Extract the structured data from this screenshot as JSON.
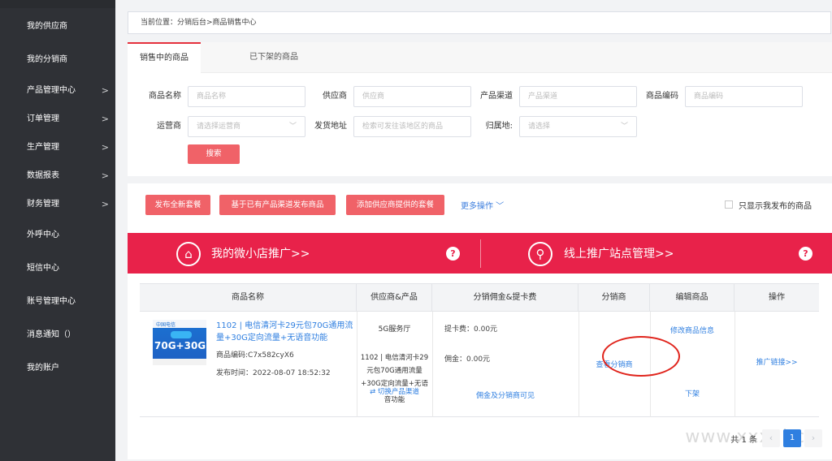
{
  "sidebar": {
    "items": [
      {
        "label": "我的供应商",
        "chevron": false
      },
      {
        "label": "我的分销商",
        "chevron": false
      },
      {
        "label": "产品管理中心",
        "chevron": true
      },
      {
        "label": "订单管理",
        "chevron": true
      },
      {
        "label": "生产管理",
        "chevron": true
      },
      {
        "label": "数据报表",
        "chevron": true
      },
      {
        "label": "财务管理",
        "chevron": true
      },
      {
        "label": "外呼中心",
        "chevron": false
      },
      {
        "label": "短信中心",
        "chevron": false
      },
      {
        "label": "账号管理中心",
        "chevron": false
      },
      {
        "label": "消息通知（）",
        "chevron": false
      },
      {
        "label": "我的账户",
        "chevron": false
      }
    ],
    "chevron_icon": ">"
  },
  "breadcrumb": "当前位置：分销后台>商品销售中心",
  "tabs": [
    "销售中的商品",
    "已下架的商品"
  ],
  "filters": {
    "product_name_label": "商品名称",
    "product_name_placeholder": "商品名称",
    "supplier_label": "供应商",
    "supplier_placeholder": "供应商",
    "channel_label": "产品渠道",
    "channel_placeholder": "产品渠道",
    "code_label": "商品编码",
    "code_placeholder": "商品编码",
    "operator_label": "运营商",
    "operator_placeholder": "请选择运营商",
    "ship_label": "发货地址",
    "ship_placeholder": "检索可发往该地区的商品",
    "region_label": "归属地:",
    "region_placeholder": "请选择",
    "search_button": "搜索"
  },
  "actions": {
    "publish_new": "发布全新套餐",
    "publish_from_channel": "基于已有产品渠道发布商品",
    "add_supplier_package": "添加供应商提供的套餐",
    "more_ops": "更多操作 ﹀",
    "only_mine": "只显示我发布的商品"
  },
  "banner": {
    "left_text": "我的微小店推广>>",
    "right_text": "线上推广站点管理>>",
    "help": "?",
    "left_icon": "shop-icon",
    "right_icon": "location-icon",
    "color": "#e8224a"
  },
  "table": {
    "headers": [
      "商品名称",
      "供应商&产品",
      "分销佣金&提卡费",
      "分销商",
      "编辑商品",
      "操作"
    ],
    "rows": [
      {
        "thumb_logo": "中国电信",
        "thumb_tag": "清河卡",
        "thumb_big": "70G+30G",
        "title": "1102 | 电信清河卡29元包70G通用流量+30G定向流量+无语音功能",
        "code": "商品编码:C7x582cyX6",
        "publish_time": "发布时间：2022-08-07 18:52:32",
        "supplier": "5G服务厅",
        "supplier_product_line1": "1102 | 电信清河卡29",
        "supplier_product_line2": "元包70G通用流量",
        "supplier_product_line3": "+30G定向流量+无语",
        "supplier_product_line4": "音功能",
        "switch_channel": "⇄ 切换产品渠道",
        "card_fee": "提卡费：0.00元",
        "commission": "佣金：0.00元",
        "commission_visible": "佣金及分销商可见",
        "view_distributors": "查看分销商",
        "edit_product": "修改商品信息",
        "unlist": "下架",
        "promo_link": "推广链接>>"
      }
    ]
  },
  "pager": {
    "total": "共 1 条",
    "current": "1",
    "prev": "‹",
    "next": "›"
  },
  "watermark": "www.xxxai.cn",
  "accent": "#e5303c",
  "link_color": "#2f7fe0"
}
